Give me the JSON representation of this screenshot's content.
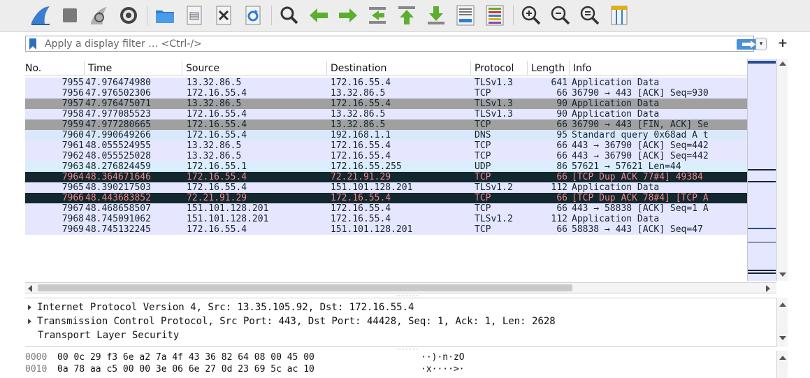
{
  "toolbar": {
    "buttons": [
      {
        "icon": "shark-fin-start-icon"
      },
      {
        "icon": "stop-capture-icon"
      },
      {
        "icon": "restart-capture-icon"
      },
      {
        "icon": "capture-options-icon"
      },
      {
        "icon": "open-file-icon"
      },
      {
        "icon": "save-file-icon"
      },
      {
        "icon": "close-file-icon"
      },
      {
        "icon": "reload-file-icon"
      },
      {
        "icon": "find-packet-icon"
      },
      {
        "icon": "go-back-icon"
      },
      {
        "icon": "go-forward-icon"
      },
      {
        "icon": "go-to-packet-icon"
      },
      {
        "icon": "first-packet-icon"
      },
      {
        "icon": "last-packet-icon"
      },
      {
        "icon": "auto-scroll-icon"
      },
      {
        "icon": "colorize-icon"
      },
      {
        "icon": "zoom-in-icon"
      },
      {
        "icon": "zoom-out-icon"
      },
      {
        "icon": "normal-size-icon"
      },
      {
        "icon": "resize-columns-icon"
      }
    ]
  },
  "filter": {
    "placeholder": "Apply a display filter … <Ctrl-/>",
    "add_label": "+"
  },
  "columns": {
    "no": "No.",
    "time": "Time",
    "source": "Source",
    "destination": "Destination",
    "protocol": "Protocol",
    "length": "Length",
    "info": "Info"
  },
  "packets": [
    {
      "no": "7955",
      "time": "47.976474980",
      "src": "13.32.86.5",
      "dst": "172.16.55.4",
      "proto": "TLSv1.3",
      "len": "641",
      "info": "Application Data",
      "style": "tls"
    },
    {
      "no": "7956",
      "time": "47.976502306",
      "src": "172.16.55.4",
      "dst": "13.32.86.5",
      "proto": "TCP",
      "len": "66",
      "info": "36790 → 443 [ACK] Seq=930",
      "style": "tcp"
    },
    {
      "no": "7957",
      "time": "47.976475071",
      "src": "13.32.86.5",
      "dst": "172.16.55.4",
      "proto": "TLSv1.3",
      "len": "90",
      "info": "Application Data",
      "style": "gray"
    },
    {
      "no": "7958",
      "time": "47.977085523",
      "src": "172.16.55.4",
      "dst": "13.32.86.5",
      "proto": "TLSv1.3",
      "len": "90",
      "info": "Application Data",
      "style": "tls"
    },
    {
      "no": "7959",
      "time": "47.977280665",
      "src": "172.16.55.4",
      "dst": "13.32.86.5",
      "proto": "TCP",
      "len": "66",
      "info": "36790 → 443 [FIN, ACK] Se",
      "style": "gray"
    },
    {
      "no": "7960",
      "time": "47.990649266",
      "src": "172.16.55.4",
      "dst": "192.168.1.1",
      "proto": "DNS",
      "len": "95",
      "info": "Standard query 0x68ad A t",
      "style": "dns"
    },
    {
      "no": "7961",
      "time": "48.055524955",
      "src": "13.32.86.5",
      "dst": "172.16.55.4",
      "proto": "TCP",
      "len": "66",
      "info": "443 → 36790 [ACK] Seq=442",
      "style": "tcp"
    },
    {
      "no": "7962",
      "time": "48.055525028",
      "src": "13.32.86.5",
      "dst": "172.16.55.4",
      "proto": "TCP",
      "len": "66",
      "info": "443 → 36790 [ACK] Seq=442",
      "style": "tcp"
    },
    {
      "no": "7963",
      "time": "48.276824459",
      "src": "172.16.55.1",
      "dst": "172.16.55.255",
      "proto": "UDP",
      "len": "86",
      "info": "57621 → 57621 Len=44",
      "style": "udp"
    },
    {
      "no": "7964",
      "time": "48.364671646",
      "src": "172.16.55.4",
      "dst": "72.21.91.29",
      "proto": "TCP",
      "len": "66",
      "info": "[TCP Dup ACK 77#4] 49384",
      "style": "bad"
    },
    {
      "no": "7965",
      "time": "48.390217503",
      "src": "172.16.55.4",
      "dst": "151.101.128.201",
      "proto": "TLSv1.2",
      "len": "112",
      "info": "Application Data",
      "style": "tls"
    },
    {
      "no": "7966",
      "time": "48.443683852",
      "src": "72.21.91.29",
      "dst": "172.16.55.4",
      "proto": "TCP",
      "len": "66",
      "info": "[TCP Dup ACK 78#4] [TCP A",
      "style": "bad"
    },
    {
      "no": "7967",
      "time": "48.468658507",
      "src": "151.101.128.201",
      "dst": "172.16.55.4",
      "proto": "TCP",
      "len": "66",
      "info": "443 → 58838 [ACK] Seq=1 A",
      "style": "tcp"
    },
    {
      "no": "7968",
      "time": "48.745091062",
      "src": "151.101.128.201",
      "dst": "172.16.55.4",
      "proto": "TLSv1.2",
      "len": "112",
      "info": "Application Data",
      "style": "tls"
    },
    {
      "no": "7969",
      "time": "48.745132245",
      "src": "172.16.55.4",
      "dst": "151.101.128.201",
      "proto": "TCP",
      "len": "66",
      "info": "58838 → 443 [ACK] Seq=47",
      "style": "tcp"
    }
  ],
  "details": [
    {
      "text": "Internet Protocol Version 4, Src: 13.35.105.92, Dst: 172.16.55.4",
      "expandable": true
    },
    {
      "text": "Transmission Control Protocol, Src Port: 443, Dst Port: 44428, Seq: 1, Ack: 1, Len: 2628",
      "expandable": true
    },
    {
      "text": "Transport Layer Security",
      "expandable": false
    }
  ],
  "bytes": [
    {
      "offset": "0000",
      "hex": "00 0c 29 f3 6e a2 7a 4f  43 36 82 64 08 00 45 00",
      "ascii": "··)·n·zO"
    },
    {
      "offset": "0010",
      "hex": "0a 78 aa c5 00 00 3e 06  6e 27 0d 23 69 5c ac 10",
      "ascii": "·x····>·"
    }
  ],
  "colors": {
    "accent": "#4a8fd9",
    "tls_row": "#e5e6ff",
    "tcp_row": "#e7e6ff",
    "gray_row": "#a0a0a0",
    "dns_row": "#dae8fc",
    "udp_row": "#daeefb",
    "bad_row_bg": "#12272e",
    "bad_row_text": "#f78787"
  }
}
